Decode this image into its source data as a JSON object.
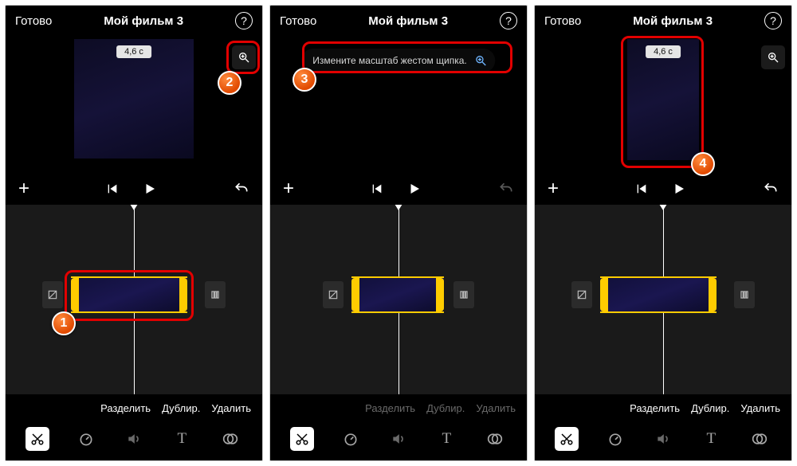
{
  "app": {
    "done_label": "Готово",
    "title": "Мой фильм 3",
    "duration_badge": "4,6 с",
    "pinch_hint": "Измените масштаб жестом щипка.",
    "actions": {
      "split": "Разделить",
      "duplicate": "Дублир.",
      "delete": "Удалить"
    },
    "tools": {
      "cut": "✂",
      "speed": "⏱",
      "volume": "🔊",
      "text": "T",
      "filter": "◑"
    },
    "markers": {
      "m1": "1",
      "m2": "2",
      "m3": "3",
      "m4": "4"
    }
  }
}
